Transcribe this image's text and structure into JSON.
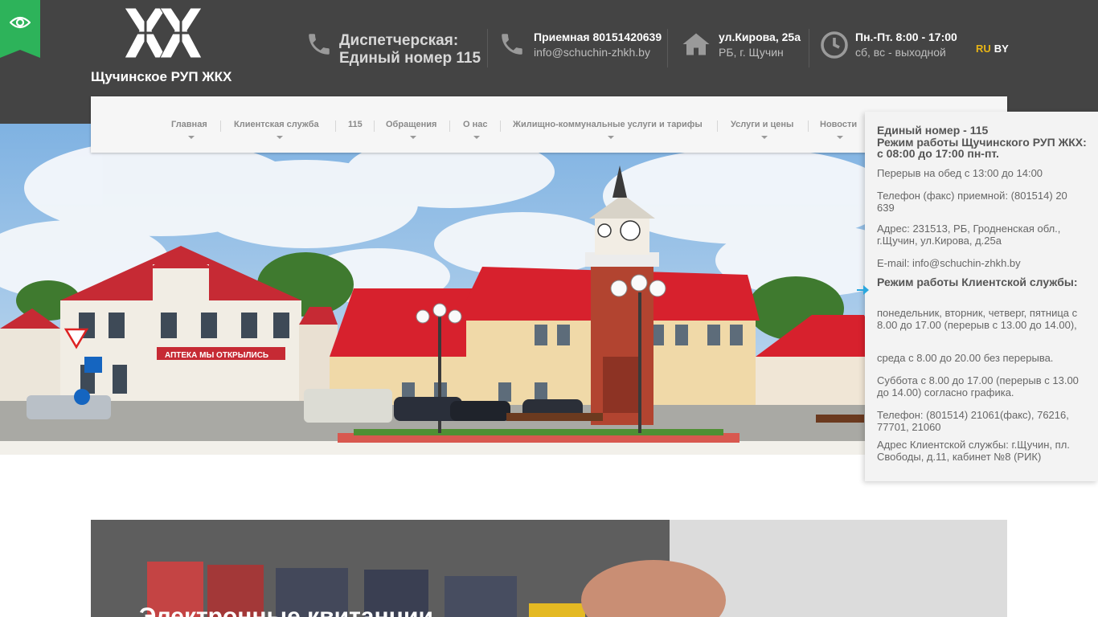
{
  "header": {
    "org_name": "Щучинское РУП ЖКХ",
    "dispatch_line1": "Диспетчерская:",
    "dispatch_line2": "Единый номер 115",
    "reception_phone": "Приемная 8015142063​9",
    "reception_email": "info@schuchin-zhkh.by",
    "address_line1": "ул.Кирова, 25а",
    "address_line2": "РБ, г. Щучин",
    "hours_line1": "Пн.-Пт. 8:00 - 17:00",
    "hours_line2": "сб, вс - выходной",
    "lang_ru": "RU",
    "lang_by": "BY",
    "accent_color": "#2db35a",
    "lang_active_color": "#e7b416"
  },
  "nav": {
    "items": [
      {
        "label": "Главная",
        "has_dropdown": true
      },
      {
        "label": "Клиентская служба",
        "has_dropdown": true
      },
      {
        "label": "115",
        "has_dropdown": false
      },
      {
        "label": "Обращения",
        "has_dropdown": true
      },
      {
        "label": "О нас",
        "has_dropdown": true
      },
      {
        "label": "Жилищно-коммунальные услуги и тарифы",
        "has_dropdown": true
      },
      {
        "label": "Услуги и цены",
        "has_dropdown": true
      },
      {
        "label": "Новости",
        "has_dropdown": true
      }
    ]
  },
  "side_panel": {
    "title1": "Единый номер - 115",
    "title2": "Режим работы Щучинского РУП ЖКХ: с 08:00 до 17:00 пн-пт.",
    "lunch": "Перерыв на обед с 13:00 до 14:00",
    "phone": "Телефон (факс) приемной: (801514) 20 639",
    "address": "Адрес: 231513, РБ, Гродненская обл., г.Щучин, ул.Кирова, д.25а",
    "email": "E-mail: info@schuchin-zhkh.by",
    "client_title": "Режим работы Клиентской службы:",
    "days1": "понедельник, вторник, четверг, пятница с 8.00 до 17.00 (перерыв с 13.00 до 14.00),",
    "days2": "среда с 8.00 до 20.00 без перерыва.",
    "days3": "Суббота с 8.00 до 17.00 (перерыв с 13.00 до 14.00) согласно графика.",
    "client_phone": "Телефон: (801514) 21061(факс), 76216, 77701, 21060",
    "client_address": "Адрес Клиентской службы: г.Щучин, пл. Свободы, д.11, кабинет №8 (РИК)",
    "arrow_color": "#2aa7de"
  },
  "hero": {
    "sign_text": "АПТЕКА МЫ ОТКРЫЛИСЬ"
  },
  "banner": {
    "title": "Электронные квитанции"
  },
  "icons": {
    "eye": "eye-icon",
    "phone": "phone-icon",
    "home": "home-icon",
    "clock": "clock-icon"
  }
}
